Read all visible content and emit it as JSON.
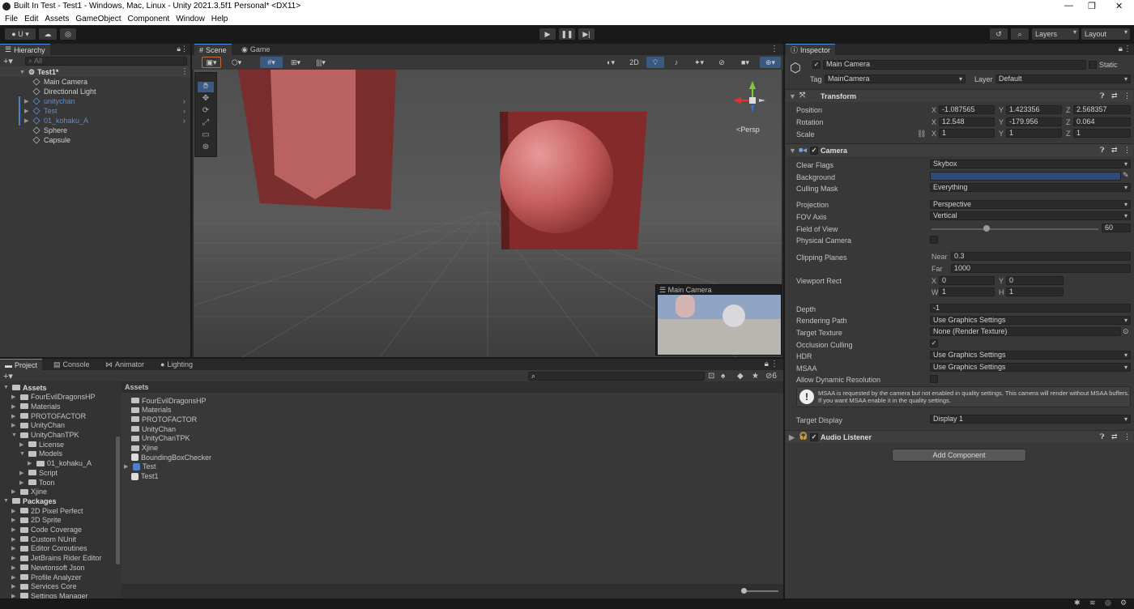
{
  "window": {
    "title": "Built In Test - Test1 - Windows, Mac, Linux - Unity 2021.3.5f1 Personal* <DX11>",
    "controls": [
      "—",
      "❐",
      "✕"
    ]
  },
  "menu": [
    "File",
    "Edit",
    "Assets",
    "GameObject",
    "Component",
    "Window",
    "Help"
  ],
  "toolbar": {
    "account": "U ▾",
    "layers": "Layers",
    "layout": "Layout"
  },
  "hierarchy": {
    "tab": "Hierarchy",
    "search_placeholder": "All",
    "scene": "Test1*",
    "items": [
      {
        "label": "Main Camera",
        "indent": 1,
        "prefab": false
      },
      {
        "label": "Directional Light",
        "indent": 1,
        "prefab": false
      },
      {
        "label": "unitychan",
        "indent": 1,
        "prefab": true
      },
      {
        "label": "Test",
        "indent": 1,
        "prefab": true
      },
      {
        "label": "01_kohaku_A",
        "indent": 1,
        "prefab": true
      },
      {
        "label": "Sphere",
        "indent": 1,
        "prefab": false
      },
      {
        "label": "Capsule",
        "indent": 1,
        "prefab": false
      }
    ]
  },
  "scene": {
    "tabs": [
      "Scene",
      "Game"
    ],
    "mode_2d": "2D",
    "persp_label": "<Persp",
    "camera_preview_title": "Main Camera"
  },
  "inspector": {
    "tab": "Inspector",
    "object_name": "Main Camera",
    "static_label": "Static",
    "tag_label": "Tag",
    "tag_value": "MainCamera",
    "layer_label": "Layer",
    "layer_value": "Default",
    "transform": {
      "title": "Transform",
      "position_label": "Position",
      "rotation_label": "Rotation",
      "scale_label": "Scale",
      "position": {
        "x": "-1.087565",
        "y": "1.423356",
        "z": "2.568357"
      },
      "rotation": {
        "x": "12.548",
        "y": "-179.956",
        "z": "0.064"
      },
      "scale": {
        "x": "1",
        "y": "1",
        "z": "1"
      }
    },
    "camera": {
      "title": "Camera",
      "clear_flags_label": "Clear Flags",
      "clear_flags": "Skybox",
      "background_label": "Background",
      "background_color": "#2e4a7a",
      "culling_mask_label": "Culling Mask",
      "culling_mask": "Everything",
      "projection_label": "Projection",
      "projection": "Perspective",
      "fov_axis_label": "FOV Axis",
      "fov_axis": "Vertical",
      "fov_label": "Field of View",
      "fov": "60",
      "fov_fraction": 0.33,
      "physical_label": "Physical Camera",
      "clipping_label": "Clipping Planes",
      "near_label": "Near",
      "near": "0.3",
      "far_label": "Far",
      "far": "1000",
      "viewport_label": "Viewport Rect",
      "vp_x": "0",
      "vp_y": "0",
      "vp_w": "1",
      "vp_h": "1",
      "depth_label": "Depth",
      "depth": "-1",
      "rendering_path_label": "Rendering Path",
      "rendering_path": "Use Graphics Settings",
      "target_texture_label": "Target Texture",
      "target_texture": "None (Render Texture)",
      "occlusion_label": "Occlusion Culling",
      "hdr_label": "HDR",
      "hdr": "Use Graphics Settings",
      "msaa_label": "MSAA",
      "msaa": "Use Graphics Settings",
      "dyn_res_label": "Allow Dynamic Resolution",
      "msaa_warning": "MSAA is requested by the camera but not enabled in quality settings. This camera will render without MSAA buffers. If you want MSAA enable it in the quality settings.",
      "target_display_label": "Target Display",
      "target_display": "Display 1"
    },
    "audio_listener": "Audio Listener",
    "add_component": "Add Component"
  },
  "project": {
    "tabs": [
      "Project",
      "Console",
      "Animator",
      "Lighting"
    ],
    "count_badge": "6",
    "tree": [
      {
        "label": "Assets",
        "indent": 0,
        "bold": true,
        "open": true
      },
      {
        "label": "FourEvilDragonsHP",
        "indent": 1
      },
      {
        "label": "Materials",
        "indent": 1
      },
      {
        "label": "PROTOFACTOR",
        "indent": 1
      },
      {
        "label": "UnityChan",
        "indent": 1
      },
      {
        "label": "UnityChanTPK",
        "indent": 1,
        "open": true
      },
      {
        "label": "License",
        "indent": 2
      },
      {
        "label": "Models",
        "indent": 2,
        "open": true
      },
      {
        "label": "01_kohaku_A",
        "indent": 3
      },
      {
        "label": "Script",
        "indent": 2
      },
      {
        "label": "Toon",
        "indent": 2
      },
      {
        "label": "Xjine",
        "indent": 1
      },
      {
        "label": "Packages",
        "indent": 0,
        "bold": true,
        "open": true
      },
      {
        "label": "2D Pixel Perfect",
        "indent": 1
      },
      {
        "label": "2D Sprite",
        "indent": 1
      },
      {
        "label": "Code Coverage",
        "indent": 1
      },
      {
        "label": "Custom NUnit",
        "indent": 1
      },
      {
        "label": "Editor Coroutines",
        "indent": 1
      },
      {
        "label": "JetBrains Rider Editor",
        "indent": 1
      },
      {
        "label": "Newtonsoft Json",
        "indent": 1
      },
      {
        "label": "Profile Analyzer",
        "indent": 1
      },
      {
        "label": "Services Core",
        "indent": 1
      },
      {
        "label": "Settings Manager",
        "indent": 1
      }
    ],
    "breadcrumb": "Assets",
    "files": [
      {
        "label": "FourEvilDragonsHP",
        "kind": "folder"
      },
      {
        "label": "Materials",
        "kind": "folder"
      },
      {
        "label": "PROTOFACTOR",
        "kind": "folder"
      },
      {
        "label": "UnityChan",
        "kind": "folder"
      },
      {
        "label": "UnityChanTPK",
        "kind": "folder"
      },
      {
        "label": "Xjine",
        "kind": "folder"
      },
      {
        "label": "BoundingBoxChecker",
        "kind": "script"
      },
      {
        "label": "Test",
        "kind": "prefab"
      },
      {
        "label": "Test1",
        "kind": "scene"
      }
    ]
  }
}
